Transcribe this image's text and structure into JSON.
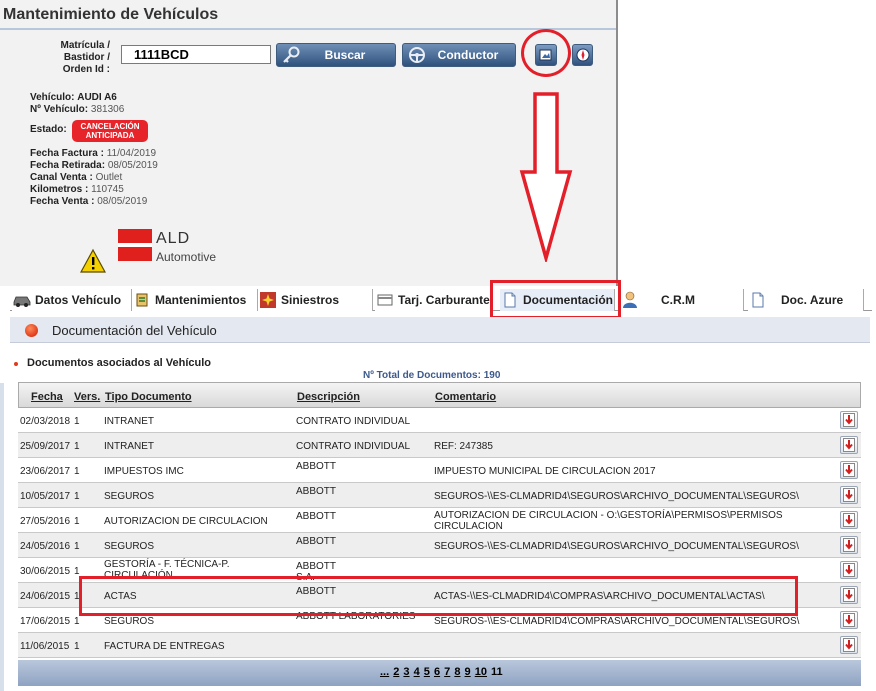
{
  "header": {
    "title": "Mantenimiento de Vehículos"
  },
  "search": {
    "label_lines": [
      "Matrícula /",
      "Bastidor /",
      "Orden Id :"
    ],
    "value": "1111BCD",
    "search_button": "Buscar",
    "driver_button": "Conductor"
  },
  "vehicle": {
    "name_label": "Vehículo:",
    "name": "AUDI A6",
    "number_label": "Nº Vehículo:",
    "number": "381306",
    "state_label": "Estado:",
    "state_line1": "CANCELACIÓN",
    "state_line2": "ANTICIPADA",
    "invoice_date_label": "Fecha Factura :",
    "invoice_date": "11/04/2019",
    "retired_date_label": "Fecha Retirada:",
    "retired_date": "08/05/2019",
    "sales_channel_label": "Canal Venta :",
    "sales_channel": "Outlet",
    "kilometers_label": "Kilometros :",
    "kilometers": "110745",
    "sale_date_label": "Fecha Venta :",
    "sale_date": "08/05/2019"
  },
  "logo": {
    "name": "ALD",
    "sub": "Automotive"
  },
  "tabs": [
    {
      "label": "Datos Vehículo",
      "icon": "car-icon"
    },
    {
      "label": "Mantenimientos",
      "icon": "maintenance-icon"
    },
    {
      "label": "Siniestros",
      "icon": "claims-icon"
    },
    {
      "label": "Tarj. Carburante",
      "icon": "fuel-card-icon"
    },
    {
      "label": "Documentación",
      "icon": "document-icon",
      "active": true
    },
    {
      "label": "C.R.M",
      "icon": "person-icon"
    },
    {
      "label": "Doc. Azure",
      "icon": "document-icon"
    }
  ],
  "section": {
    "title": "Documentación del Vehículo",
    "subtitle": "Documentos asociados al Vehículo",
    "total": "Nº Total de Documentos: 190"
  },
  "table": {
    "headers": [
      "Fecha",
      "Vers.",
      "Tipo Documento",
      "Descripción",
      "Comentario"
    ],
    "rows": [
      {
        "date": "02/03/2018",
        "ver": "1",
        "type": "INTRANET",
        "desc": "CONTRATO INDIVIDUAL",
        "comment": ""
      },
      {
        "date": "25/09/2017",
        "ver": "1",
        "type": "INTRANET",
        "desc": "CONTRATO INDIVIDUAL",
        "comment": "REF: 247385"
      },
      {
        "date": "23/06/2017",
        "ver": "1",
        "type": "IMPUESTOS IMC",
        "desc": "ABBOTT",
        "comment": "IMPUESTO MUNICIPAL DE CIRCULACION 2017"
      },
      {
        "date": "10/05/2017",
        "ver": "1",
        "type": "SEGUROS",
        "desc": "ABBOTT",
        "comment": "SEGUROS-\\\\ES-CLMADRID4\\SEGUROS\\ARCHIVO_DOCUMENTAL\\SEGUROS\\"
      },
      {
        "date": "27/05/2016",
        "ver": "1",
        "type": "AUTORIZACION DE CIRCULACION",
        "desc": "ABBOTT",
        "comment": "AUTORIZACION DE CIRCULACION - O:\\GESTORÍA\\PERMISOS\\PERMISOS",
        "comment2": "CIRCULACION"
      },
      {
        "date": "24/05/2016",
        "ver": "1",
        "type": "SEGUROS",
        "desc": "ABBOTT",
        "comment": "SEGUROS-\\\\ES-CLMADRID4\\SEGUROS\\ARCHIVO_DOCUMENTAL\\SEGUROS\\"
      },
      {
        "date": "30/06/2015",
        "ver": "1",
        "type": "GESTORÍA - F. TÉCNICA-P.",
        "type2": "CIRCULACIÓN",
        "desc": "ABBOTT",
        "desc2": "S.A.",
        "comment": ""
      },
      {
        "date": "24/06/2015",
        "ver": "1",
        "type": "ACTAS",
        "desc": "ABBOTT",
        "comment": "ACTAS-\\\\ES-CLMADRID4\\COMPRAS\\ARCHIVO_DOCUMENTAL\\ACTAS\\"
      },
      {
        "date": "17/06/2015",
        "ver": "1",
        "type": "SEGUROS",
        "desc": "ABBOTT LABORATORIES",
        "comment": "SEGUROS-\\\\ES-CLMADRID4\\COMPRAS\\ARCHIVO_DOCUMENTAL\\SEGUROS\\"
      },
      {
        "date": "11/06/2015",
        "ver": "1",
        "type": "FACTURA DE ENTREGAS",
        "desc": "",
        "comment": ""
      }
    ]
  },
  "pager": {
    "prev": "...",
    "pages": [
      "2",
      "3",
      "4",
      "5",
      "6",
      "7",
      "8",
      "9",
      "10"
    ],
    "current": "11"
  },
  "colors": {
    "accent_red": "#e3202a",
    "button_blue": "#2f527d",
    "badge_red": "#e8242b"
  }
}
